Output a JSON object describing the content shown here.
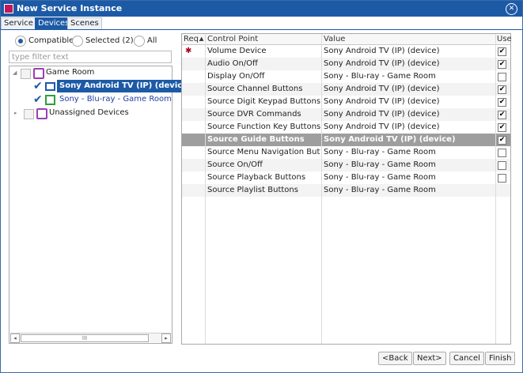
{
  "window": {
    "title": "New Service Instance",
    "icons": {
      "app": "service-app-icon",
      "close": "close-icon"
    }
  },
  "tabs": [
    {
      "label": "Service"
    },
    {
      "label": "Devices"
    },
    {
      "label": "Scenes"
    }
  ],
  "filter_mode": {
    "options": [
      {
        "label": "Compatible"
      },
      {
        "label": "Selected (2)"
      },
      {
        "label": "All"
      }
    ],
    "selected": "Compatible"
  },
  "filter": {
    "placeholder": "type filter text",
    "value": ""
  },
  "tree": {
    "groups": [
      {
        "label": "Game Room",
        "icon": "room-folder-icon",
        "children": [
          {
            "label": "Sony Android TV (IP) (device)",
            "checked": true,
            "icon": "tv-device-icon",
            "selected": true
          },
          {
            "label": "Sony - Blu-ray - Game Room",
            "checked": true,
            "icon": "bluray-device-icon",
            "selected": false
          }
        ]
      },
      {
        "label": "Unassigned Devices",
        "icon": "room-folder-icon"
      }
    ],
    "scroll_arrows": [
      "◂",
      "▸"
    ],
    "scroll_thumb_grip": "III"
  },
  "grid": {
    "columns": {
      "req": "Req.",
      "sort_indicator": "▲",
      "control_point": "Control Point",
      "value": "Value",
      "use": "Use"
    },
    "required_marker": "✱",
    "rows": [
      {
        "control_point": "Volume Device",
        "value": "Sony Android TV (IP) (device)",
        "required": true,
        "use": true
      },
      {
        "control_point": "Audio On/Off",
        "value": "Sony Android TV (IP) (device)",
        "required": false,
        "use": true
      },
      {
        "control_point": "Display On/Off",
        "value": "Sony - Blu-ray - Game Room",
        "required": false,
        "use": false
      },
      {
        "control_point": "Source Channel Buttons",
        "value": "Sony Android TV (IP) (device)",
        "required": false,
        "use": true
      },
      {
        "control_point": "Source Digit Keypad Buttons",
        "value": "Sony Android TV (IP) (device)",
        "required": false,
        "use": true
      },
      {
        "control_point": "Source DVR Commands",
        "value": "Sony Android TV (IP) (device)",
        "required": false,
        "use": true
      },
      {
        "control_point": "Source Function Key Buttons",
        "value": "Sony Android TV (IP) (device)",
        "required": false,
        "use": true
      },
      {
        "control_point": "Source Guide Buttons",
        "value": "Sony Android TV (IP) (device)",
        "required": false,
        "use": true,
        "selected": true
      },
      {
        "control_point": "Source Menu Navigation Buttons",
        "value": "Sony - Blu-ray - Game Room",
        "required": false,
        "use": false
      },
      {
        "control_point": "Source On/Off",
        "value": "Sony - Blu-ray - Game Room",
        "required": false,
        "use": false
      },
      {
        "control_point": "Source Playback Buttons",
        "value": "Sony - Blu-ray - Game Room",
        "required": false,
        "use": false
      },
      {
        "control_point": "Source Playlist Buttons",
        "value": "Sony - Blu-ray - Game Room",
        "required": false,
        "use": null
      }
    ]
  },
  "buttons": {
    "back": "<Back",
    "next": "Next>",
    "cancel": "Cancel",
    "finish": "Finish"
  },
  "colors": {
    "accent": "#1d5aa6",
    "selected_row": "#9e9e9e",
    "required": "#b00020"
  }
}
